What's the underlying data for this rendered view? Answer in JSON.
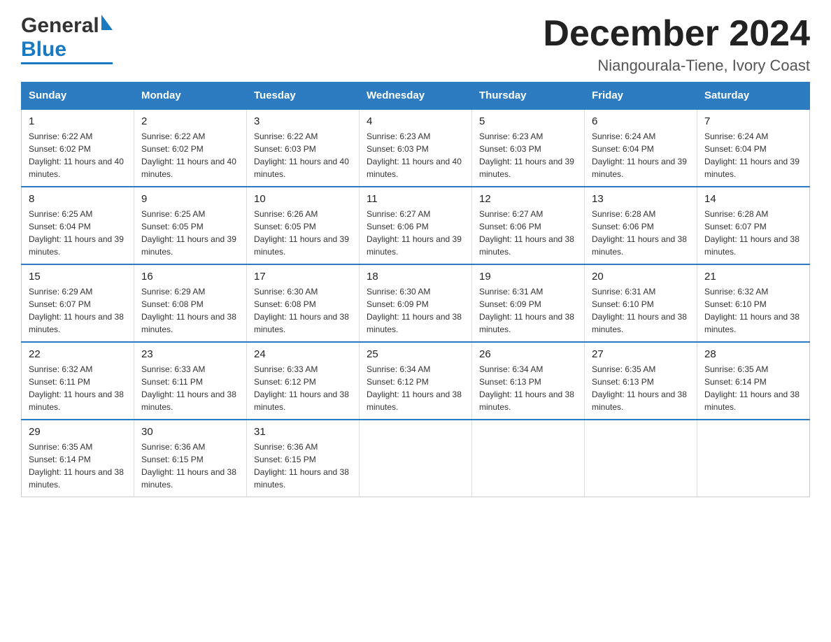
{
  "logo": {
    "general": "General",
    "blue": "Blue"
  },
  "header": {
    "title": "December 2024",
    "subtitle": "Niangourala-Tiene, Ivory Coast"
  },
  "days": [
    "Sunday",
    "Monday",
    "Tuesday",
    "Wednesday",
    "Thursday",
    "Friday",
    "Saturday"
  ],
  "weeks": [
    [
      {
        "num": "1",
        "sunrise": "6:22 AM",
        "sunset": "6:02 PM",
        "daylight": "11 hours and 40 minutes."
      },
      {
        "num": "2",
        "sunrise": "6:22 AM",
        "sunset": "6:02 PM",
        "daylight": "11 hours and 40 minutes."
      },
      {
        "num": "3",
        "sunrise": "6:22 AM",
        "sunset": "6:03 PM",
        "daylight": "11 hours and 40 minutes."
      },
      {
        "num": "4",
        "sunrise": "6:23 AM",
        "sunset": "6:03 PM",
        "daylight": "11 hours and 40 minutes."
      },
      {
        "num": "5",
        "sunrise": "6:23 AM",
        "sunset": "6:03 PM",
        "daylight": "11 hours and 39 minutes."
      },
      {
        "num": "6",
        "sunrise": "6:24 AM",
        "sunset": "6:04 PM",
        "daylight": "11 hours and 39 minutes."
      },
      {
        "num": "7",
        "sunrise": "6:24 AM",
        "sunset": "6:04 PM",
        "daylight": "11 hours and 39 minutes."
      }
    ],
    [
      {
        "num": "8",
        "sunrise": "6:25 AM",
        "sunset": "6:04 PM",
        "daylight": "11 hours and 39 minutes."
      },
      {
        "num": "9",
        "sunrise": "6:25 AM",
        "sunset": "6:05 PM",
        "daylight": "11 hours and 39 minutes."
      },
      {
        "num": "10",
        "sunrise": "6:26 AM",
        "sunset": "6:05 PM",
        "daylight": "11 hours and 39 minutes."
      },
      {
        "num": "11",
        "sunrise": "6:27 AM",
        "sunset": "6:06 PM",
        "daylight": "11 hours and 39 minutes."
      },
      {
        "num": "12",
        "sunrise": "6:27 AM",
        "sunset": "6:06 PM",
        "daylight": "11 hours and 38 minutes."
      },
      {
        "num": "13",
        "sunrise": "6:28 AM",
        "sunset": "6:06 PM",
        "daylight": "11 hours and 38 minutes."
      },
      {
        "num": "14",
        "sunrise": "6:28 AM",
        "sunset": "6:07 PM",
        "daylight": "11 hours and 38 minutes."
      }
    ],
    [
      {
        "num": "15",
        "sunrise": "6:29 AM",
        "sunset": "6:07 PM",
        "daylight": "11 hours and 38 minutes."
      },
      {
        "num": "16",
        "sunrise": "6:29 AM",
        "sunset": "6:08 PM",
        "daylight": "11 hours and 38 minutes."
      },
      {
        "num": "17",
        "sunrise": "6:30 AM",
        "sunset": "6:08 PM",
        "daylight": "11 hours and 38 minutes."
      },
      {
        "num": "18",
        "sunrise": "6:30 AM",
        "sunset": "6:09 PM",
        "daylight": "11 hours and 38 minutes."
      },
      {
        "num": "19",
        "sunrise": "6:31 AM",
        "sunset": "6:09 PM",
        "daylight": "11 hours and 38 minutes."
      },
      {
        "num": "20",
        "sunrise": "6:31 AM",
        "sunset": "6:10 PM",
        "daylight": "11 hours and 38 minutes."
      },
      {
        "num": "21",
        "sunrise": "6:32 AM",
        "sunset": "6:10 PM",
        "daylight": "11 hours and 38 minutes."
      }
    ],
    [
      {
        "num": "22",
        "sunrise": "6:32 AM",
        "sunset": "6:11 PM",
        "daylight": "11 hours and 38 minutes."
      },
      {
        "num": "23",
        "sunrise": "6:33 AM",
        "sunset": "6:11 PM",
        "daylight": "11 hours and 38 minutes."
      },
      {
        "num": "24",
        "sunrise": "6:33 AM",
        "sunset": "6:12 PM",
        "daylight": "11 hours and 38 minutes."
      },
      {
        "num": "25",
        "sunrise": "6:34 AM",
        "sunset": "6:12 PM",
        "daylight": "11 hours and 38 minutes."
      },
      {
        "num": "26",
        "sunrise": "6:34 AM",
        "sunset": "6:13 PM",
        "daylight": "11 hours and 38 minutes."
      },
      {
        "num": "27",
        "sunrise": "6:35 AM",
        "sunset": "6:13 PM",
        "daylight": "11 hours and 38 minutes."
      },
      {
        "num": "28",
        "sunrise": "6:35 AM",
        "sunset": "6:14 PM",
        "daylight": "11 hours and 38 minutes."
      }
    ],
    [
      {
        "num": "29",
        "sunrise": "6:35 AM",
        "sunset": "6:14 PM",
        "daylight": "11 hours and 38 minutes."
      },
      {
        "num": "30",
        "sunrise": "6:36 AM",
        "sunset": "6:15 PM",
        "daylight": "11 hours and 38 minutes."
      },
      {
        "num": "31",
        "sunrise": "6:36 AM",
        "sunset": "6:15 PM",
        "daylight": "11 hours and 38 minutes."
      },
      null,
      null,
      null,
      null
    ]
  ]
}
